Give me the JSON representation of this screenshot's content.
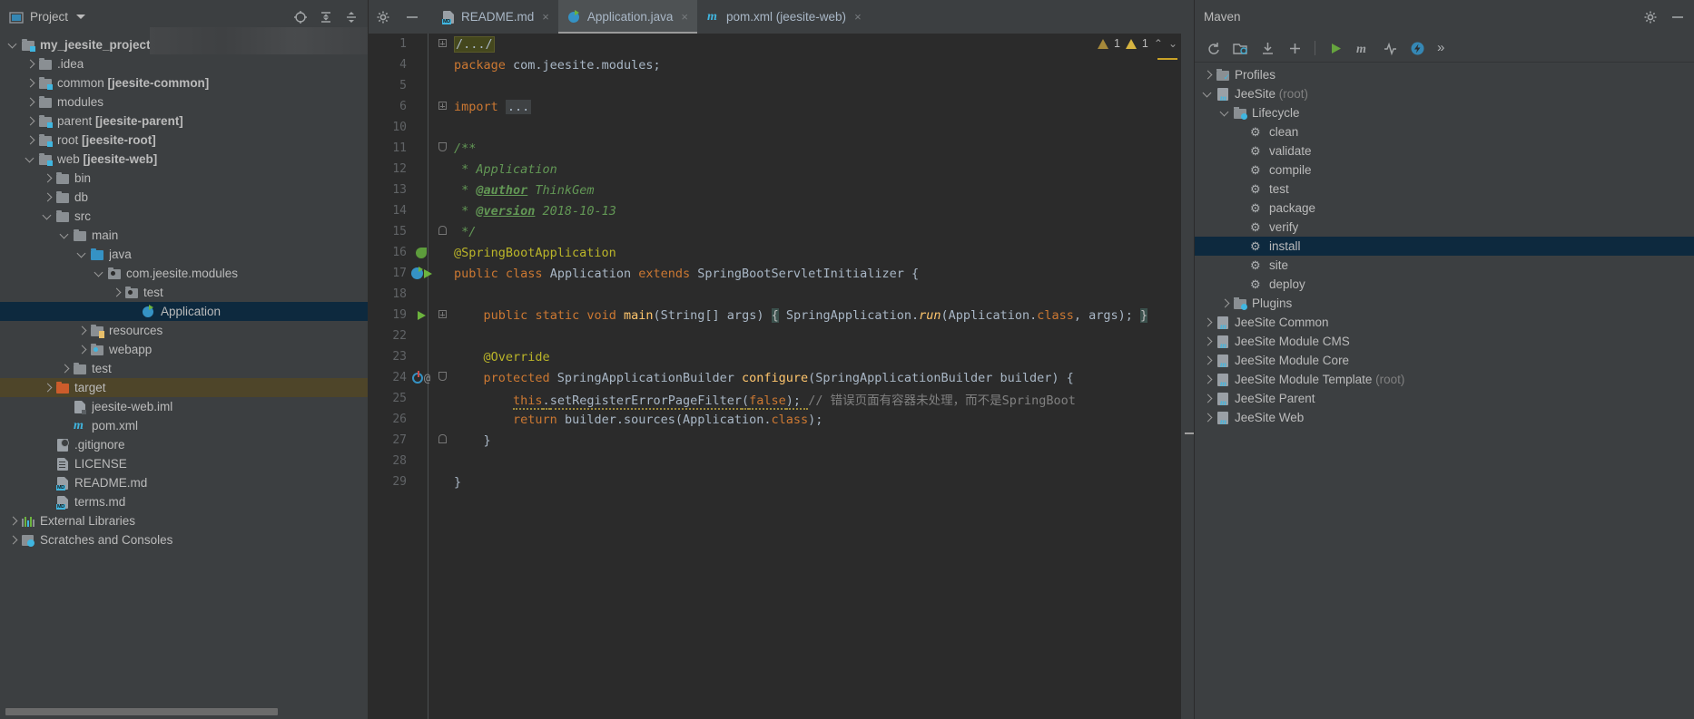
{
  "project_panel": {
    "title": "Project",
    "header_icons": [
      "locate-icon",
      "expand-all-icon",
      "collapse-all-icon",
      "settings-gear-icon",
      "hide-icon"
    ],
    "tree": [
      {
        "label": "my_jeesite_project",
        "indent": 0,
        "arrow": "open",
        "icon": "module-folder-icon",
        "bold": true
      },
      {
        "label": ".idea",
        "indent": 1,
        "arrow": "closed",
        "icon": "folder-icon"
      },
      {
        "label": "common ",
        "suffix": "[jeesite-common]",
        "indent": 1,
        "arrow": "closed",
        "icon": "module-folder-icon"
      },
      {
        "label": "modules",
        "indent": 1,
        "arrow": "closed",
        "icon": "folder-icon"
      },
      {
        "label": "parent ",
        "suffix": "[jeesite-parent]",
        "indent": 1,
        "arrow": "closed",
        "icon": "module-folder-icon"
      },
      {
        "label": "root ",
        "suffix": "[jeesite-root]",
        "indent": 1,
        "arrow": "closed",
        "icon": "module-folder-icon"
      },
      {
        "label": "web ",
        "suffix": "[jeesite-web]",
        "indent": 1,
        "arrow": "open",
        "icon": "module-folder-icon"
      },
      {
        "label": "bin",
        "indent": 2,
        "arrow": "closed",
        "icon": "folder-icon"
      },
      {
        "label": "db",
        "indent": 2,
        "arrow": "closed",
        "icon": "folder-icon"
      },
      {
        "label": "src",
        "indent": 2,
        "arrow": "open",
        "icon": "folder-icon"
      },
      {
        "label": "main",
        "indent": 3,
        "arrow": "open",
        "icon": "folder-icon"
      },
      {
        "label": "java",
        "indent": 4,
        "arrow": "open",
        "icon": "source-folder-icon"
      },
      {
        "label": "com.jeesite.modules",
        "indent": 5,
        "arrow": "open",
        "icon": "package-icon"
      },
      {
        "label": "test",
        "indent": 6,
        "arrow": "closed",
        "icon": "package-icon"
      },
      {
        "label": "Application",
        "indent": 7,
        "arrow": "none",
        "icon": "spring-class-icon",
        "selected": true
      },
      {
        "label": "resources",
        "indent": 4,
        "arrow": "closed",
        "icon": "resources-folder-icon"
      },
      {
        "label": "webapp",
        "indent": 4,
        "arrow": "closed",
        "icon": "webapp-folder-icon"
      },
      {
        "label": "test",
        "indent": 3,
        "arrow": "closed",
        "icon": "folder-icon"
      },
      {
        "label": "target",
        "indent": 2,
        "arrow": "closed",
        "icon": "excluded-folder-icon",
        "highlighted": true
      },
      {
        "label": "jeesite-web.iml",
        "indent": 3,
        "arrow": "none",
        "icon": "iml-file-icon"
      },
      {
        "label": "pom.xml",
        "indent": 3,
        "arrow": "none",
        "icon": "maven-pom-icon"
      },
      {
        "label": ".gitignore",
        "indent": 2,
        "arrow": "none",
        "icon": "gitignore-file-icon"
      },
      {
        "label": "LICENSE",
        "indent": 2,
        "arrow": "none",
        "icon": "text-file-icon"
      },
      {
        "label": "README.md",
        "indent": 2,
        "arrow": "none",
        "icon": "markdown-file-icon"
      },
      {
        "label": "terms.md",
        "indent": 2,
        "arrow": "none",
        "icon": "markdown-file-icon"
      },
      {
        "label": "External Libraries",
        "indent": 0,
        "arrow": "closed",
        "icon": "libraries-icon"
      },
      {
        "label": "Scratches and Consoles",
        "indent": 0,
        "arrow": "closed",
        "icon": "scratches-icon"
      }
    ]
  },
  "editor": {
    "toolbar_icons": [
      "settings-gear-icon",
      "minimize-icon"
    ],
    "tabs": [
      {
        "label": "README.md",
        "icon": "markdown-file-icon",
        "active": false,
        "close": "×"
      },
      {
        "label": "Application.java",
        "icon": "spring-class-icon",
        "active": true,
        "close": "×"
      },
      {
        "label": "pom.xml (jeesite-web)",
        "icon": "maven-pom-icon",
        "active": false,
        "close": "×"
      }
    ],
    "warnings": {
      "count_weak": "1",
      "count_strong": "1",
      "up": "⌃",
      "down": "⌄"
    },
    "line_numbers": [
      "1",
      "4",
      "5",
      "6",
      "10",
      "11",
      "12",
      "13",
      "14",
      "15",
      "16",
      "17",
      "18",
      "19",
      "22",
      "23",
      "24",
      "25",
      "26",
      "27",
      "28",
      "29"
    ],
    "code": {
      "l1_fold": "/.../",
      "l4": {
        "kw": "package",
        "rest": " com.jeesite.modules;"
      },
      "l6": {
        "kw": "import",
        "fold": "..."
      },
      "l11": "/**",
      "l12": " * Application",
      "l13_star": " * ",
      "l13_tag": "@author",
      "l13_rest": " ThinkGem",
      "l14_star": " * ",
      "l14_tag": "@version",
      "l14_rest": " 2018-10-13",
      "l15": " */",
      "l16": "@SpringBootApplication",
      "l17": {
        "k1": "public",
        "k2": "class",
        "name": " Application ",
        "k3": "extends",
        "rest": " SpringBootServletInitializer {"
      },
      "l19": {
        "k1": "public",
        "k2": "static",
        "k3": "void",
        "m": "main",
        "p1": "(String[] args) ",
        "brace": "{",
        "body": " SpringApplication.",
        "run": "run",
        "args": "(Application.",
        "cls": "class",
        "tail": ", args); ",
        "end": "}"
      },
      "l23": "@Override",
      "l24": {
        "kw": "protected",
        "t": " SpringApplicationBuilder ",
        "m": "configure",
        "rest": "(SpringApplicationBuilder builder) {"
      },
      "l25": {
        "this": "this",
        "dot": ".",
        "m": "setRegisterErrorPageFilter",
        "open": "(",
        "f": "false",
        "close": "); ",
        "cmt": "// 错误页面有容器未处理，而不是SpringBoot"
      },
      "l26": {
        "kw": "return",
        "rest": " builder.sources(Application.",
        "cls": "class",
        "tail": ");"
      },
      "l27": "}",
      "l29": "}"
    }
  },
  "maven_panel": {
    "title": "Maven",
    "header_icons": [
      "settings-gear-icon",
      "minimize-icon"
    ],
    "toolbar_icons": [
      "reimport-icon",
      "generate-sources-icon",
      "download-sources-icon",
      "add-icon",
      "run-icon",
      "execute-maven-goal-icon",
      "toggle-skip-tests-icon",
      "toggle-offline-icon",
      "more-icon"
    ],
    "more_label": "»",
    "tree": [
      {
        "label": "Profiles",
        "indent": 0,
        "arrow": "closed",
        "icon": "profiles-folder-icon"
      },
      {
        "label": "JeeSite ",
        "suffix": "(root)",
        "indent": 0,
        "arrow": "open",
        "icon": "maven-module-icon"
      },
      {
        "label": "Lifecycle",
        "indent": 1,
        "arrow": "open",
        "icon": "lifecycle-folder-icon"
      },
      {
        "label": "clean",
        "indent": 2,
        "arrow": "none",
        "icon": "goal-gear-icon"
      },
      {
        "label": "validate",
        "indent": 2,
        "arrow": "none",
        "icon": "goal-gear-icon"
      },
      {
        "label": "compile",
        "indent": 2,
        "arrow": "none",
        "icon": "goal-gear-icon"
      },
      {
        "label": "test",
        "indent": 2,
        "arrow": "none",
        "icon": "goal-gear-icon"
      },
      {
        "label": "package",
        "indent": 2,
        "arrow": "none",
        "icon": "goal-gear-icon"
      },
      {
        "label": "verify",
        "indent": 2,
        "arrow": "none",
        "icon": "goal-gear-icon"
      },
      {
        "label": "install",
        "indent": 2,
        "arrow": "none",
        "icon": "goal-gear-icon",
        "selected": true
      },
      {
        "label": "site",
        "indent": 2,
        "arrow": "none",
        "icon": "goal-gear-icon"
      },
      {
        "label": "deploy",
        "indent": 2,
        "arrow": "none",
        "icon": "goal-gear-icon"
      },
      {
        "label": "Plugins",
        "indent": 1,
        "arrow": "closed",
        "icon": "plugins-folder-icon"
      },
      {
        "label": "JeeSite Common",
        "indent": 0,
        "arrow": "closed",
        "icon": "maven-module-icon"
      },
      {
        "label": "JeeSite Module CMS",
        "indent": 0,
        "arrow": "closed",
        "icon": "maven-module-icon"
      },
      {
        "label": "JeeSite Module Core",
        "indent": 0,
        "arrow": "closed",
        "icon": "maven-module-icon"
      },
      {
        "label": "JeeSite Module Template ",
        "suffix": "(root)",
        "indent": 0,
        "arrow": "closed",
        "icon": "maven-module-icon"
      },
      {
        "label": "JeeSite Parent",
        "indent": 0,
        "arrow": "closed",
        "icon": "maven-module-icon"
      },
      {
        "label": "JeeSite Web",
        "indent": 0,
        "arrow": "closed",
        "icon": "maven-module-icon"
      }
    ]
  },
  "colors": {
    "bg_panel": "#3c3f41",
    "bg_editor": "#2b2b2b",
    "selection": "#0d293e",
    "target_highlight": "#4e4529",
    "accent_blue": "#3592c4",
    "green_run": "#6cb33e",
    "keyword_orange": "#cc7832",
    "comment_green": "#629755",
    "annotation_yellow": "#bbb529"
  }
}
